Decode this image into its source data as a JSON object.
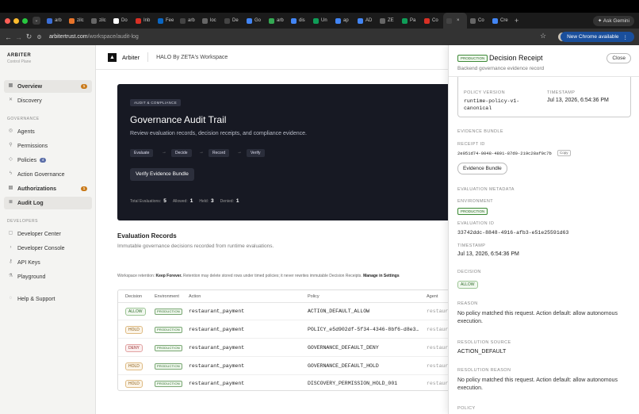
{
  "browser": {
    "tabs": [
      {
        "label": "arb",
        "icon": "arbiter-favicon",
        "color": "#3b6fd8"
      },
      {
        "label": "zilc",
        "icon": "zilc-favicon",
        "color": "#e8742a"
      },
      {
        "label": "zilc",
        "icon": "zilc-favicon-2",
        "color": "#666666"
      },
      {
        "label": "Do",
        "icon": "doc-favicon",
        "color": "#ffffff"
      },
      {
        "label": "Inb",
        "icon": "gmail-favicon",
        "color": "#d93025"
      },
      {
        "label": "Fee",
        "icon": "linkedin-favicon",
        "color": "#0a66c2"
      },
      {
        "label": "arb",
        "icon": "arbiter-favicon",
        "color": "#444444"
      },
      {
        "label": "loc",
        "icon": "globe-favicon",
        "color": "#666666"
      },
      {
        "label": "De",
        "icon": "arbiter-favicon",
        "color": "#444444"
      },
      {
        "label": "Go",
        "icon": "gdocs-favicon",
        "color": "#4285f4"
      },
      {
        "label": "arb",
        "icon": "gdrive-favicon",
        "color": "#34a853"
      },
      {
        "label": "dis",
        "icon": "gdocs-favicon",
        "color": "#4285f4"
      },
      {
        "label": "Un",
        "icon": "sheets-favicon",
        "color": "#0f9d58"
      },
      {
        "label": "ap",
        "icon": "gdocs-favicon",
        "color": "#4285f4"
      },
      {
        "label": "AD",
        "icon": "gdocs-favicon",
        "color": "#4285f4"
      },
      {
        "label": "ZE",
        "icon": "globe-favicon",
        "color": "#666666"
      },
      {
        "label": "Pa",
        "icon": "pay-favicon",
        "color": "#0f9d58"
      },
      {
        "label": "Co",
        "icon": "pdf-favicon",
        "color": "#d93025"
      },
      {
        "label": "",
        "icon": "arbiter-favicon",
        "color": "#444444",
        "active": true
      },
      {
        "label": "Co",
        "icon": "chrome-favicon",
        "color": "#666666"
      },
      {
        "label": "Cre",
        "icon": "google-favicon",
        "color": "#4285f4"
      }
    ],
    "ask_gemini": "Ask Gemini",
    "url_host": "arbitertrust.com",
    "url_path": "/workspace/audit-log",
    "update_button": "New Chrome available"
  },
  "sidebar": {
    "brand": "ARBITER",
    "brand_sub": "Control Plane",
    "items": [
      {
        "label": "Overview",
        "icon": "grid-icon",
        "badge": "1"
      },
      {
        "label": "Discovery",
        "icon": "sparkle-icon"
      }
    ],
    "governance_heading": "GOVERNANCE",
    "governance_items": [
      {
        "label": "Agents",
        "icon": "agent-icon"
      },
      {
        "label": "Permissions",
        "icon": "key-icon"
      },
      {
        "label": "Policies",
        "icon": "shield-icon",
        "badge": "4"
      },
      {
        "label": "Action Governance",
        "icon": "bolt-icon"
      },
      {
        "label": "Authorizations",
        "icon": "clipboard-icon",
        "badge": "1"
      },
      {
        "label": "Audit Log",
        "icon": "log-icon"
      }
    ],
    "developers_heading": "DEVELOPERS",
    "developer_items": [
      {
        "label": "Developer Center",
        "icon": "box-icon"
      },
      {
        "label": "Developer Console",
        "icon": "terminal-icon"
      },
      {
        "label": "API Keys",
        "icon": "key-icon"
      },
      {
        "label": "Playground",
        "icon": "flask-icon"
      }
    ],
    "help": {
      "label": "Help & Support",
      "icon": "help-icon"
    }
  },
  "topbar": {
    "app_name": "Arbiter",
    "workspace": "HALO By ZETA's Workspace"
  },
  "hero": {
    "chip": "AUDIT & COMPLIANCE",
    "title": "Governance Audit Trail",
    "subtitle": "Review evaluation records, decision receipts, and compliance evidence.",
    "steps": [
      "Evaluate",
      "Decide",
      "Record",
      "Verify"
    ],
    "verify_button": "Verify Evidence Bundle",
    "stats": [
      {
        "label": "Total Evaluations:",
        "value": "5"
      },
      {
        "label": "Allowed:",
        "value": "1"
      },
      {
        "label": "Held:",
        "value": "3"
      },
      {
        "label": "Denied:",
        "value": "1"
      }
    ]
  },
  "records": {
    "title": "Evaluation Records",
    "subtitle": "Immutable governance decisions recorded from runtime evaluations.",
    "retention_prefix": "Workspace retention:",
    "retention_value": "Keep Forever.",
    "retention_text": "Retention may delete stored rows under timed policies; it never rewrites immutable Decision Receipts.",
    "retention_link": "Manage in Settings",
    "columns": [
      "Decision",
      "Environment",
      "Action",
      "Policy",
      "Agent"
    ],
    "rows": [
      {
        "decision": "ALLOW",
        "env": "PRODUCTION",
        "action": "restaurant_payment",
        "policy": "ACTION_DEFAULT_ALLOW",
        "agent": "restaura"
      },
      {
        "decision": "HOLD",
        "env": "PRODUCTION",
        "action": "restaurant_payment",
        "policy": "POLICY_e5d902df-5f34-4346-8bf6-d8e3…",
        "agent": "restaura"
      },
      {
        "decision": "DENY",
        "env": "PRODUCTION",
        "action": "restaurant_payment",
        "policy": "GOVERNANCE_DEFAULT_DENY",
        "agent": "restaura"
      },
      {
        "decision": "HOLD",
        "env": "PRODUCTION",
        "action": "restaurant_payment",
        "policy": "GOVERNANCE_DEFAULT_HOLD",
        "agent": "restaura"
      },
      {
        "decision": "HOLD",
        "env": "PRODUCTION",
        "action": "restaurant_payment",
        "policy": "DISCOVERY_PERMISSION_HOLD_001",
        "agent": "restaura"
      }
    ]
  },
  "panel": {
    "chip": "PRODUCTION",
    "title": "Decision Receipt",
    "subtitle": "Backend governance evidence record",
    "close": "Close",
    "policy_version_label": "POLICY VERSION",
    "policy_version": "runtime-policy-v1-canonical",
    "timestamp_label": "TIMESTAMP",
    "timestamp": "Jul 13, 2026, 6:54:36 PM",
    "evidence_heading": "EVIDENCE BUNDLE",
    "receipt_label": "RECEIPT ID",
    "receipt_id": "2e051d74-0048-4891-87d0-219c28af0c7b",
    "copy": "Copy",
    "evidence_button": "Evidence Bundle",
    "meta_heading": "EVALUATION METADATA",
    "env_label": "ENVIRONMENT",
    "env_value": "PRODUCTION",
    "eval_id_label": "EVALUATION ID",
    "eval_id": "33742ddc-8848-4916-afb3-e51e25591d63",
    "ts_label": "TIMESTAMP",
    "ts_value": "Jul 13, 2026, 6:54:36 PM",
    "decision_heading": "DECISION",
    "decision_value": "ALLOW",
    "reason_label": "REASON",
    "reason": "No policy matched this request. Action default: allow autonomous execution.",
    "res_source_label": "RESOLUTION SOURCE",
    "res_source": "ACTION_DEFAULT",
    "res_reason_label": "RESOLUTION REASON",
    "res_reason": "No policy matched this request. Action default: allow autonomous execution.",
    "policy_label": "POLICY"
  }
}
